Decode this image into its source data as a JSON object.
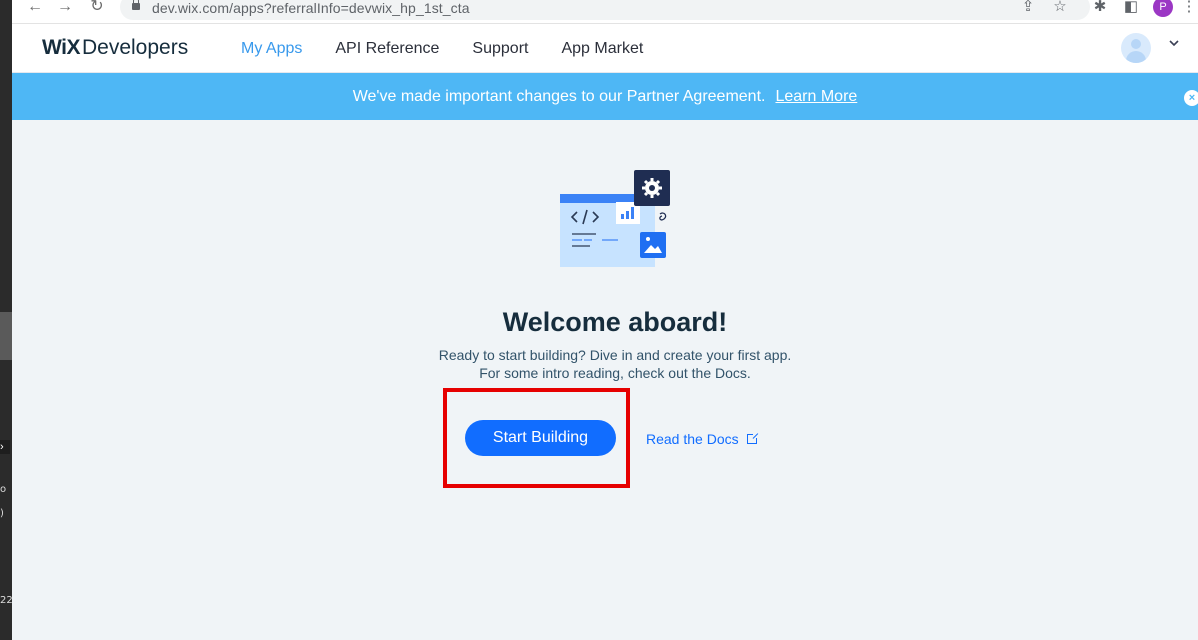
{
  "browser": {
    "url": "dev.wix.com/apps?referralInfo=devwix_hp_1st_cta",
    "profile_initial": "P"
  },
  "header": {
    "logo_wix": "WiX",
    "logo_developers": "Developers",
    "nav": [
      {
        "label": "My Apps",
        "active": true
      },
      {
        "label": "API Reference",
        "active": false
      },
      {
        "label": "Support",
        "active": false
      },
      {
        "label": "App Market",
        "active": false
      }
    ]
  },
  "banner": {
    "message": "We've made important changes to our Partner Agreement.",
    "link": "Learn More"
  },
  "welcome": {
    "title": "Welcome aboard!",
    "line1": "Ready to start building? Dive in and create your first app.",
    "line2": "For some intro reading, check out the Docs.",
    "primary_button": "Start Building",
    "docs_link": "Read the Docs"
  },
  "left_edge": {
    "num": "22"
  },
  "colors": {
    "accent": "#116dff",
    "nav_active": "#3899ec",
    "banner": "#4eb7f5",
    "highlight": "#e60000",
    "background": "#f0f4f7"
  },
  "icons": [
    "back-icon",
    "forward-icon",
    "reload-icon",
    "lock-icon",
    "share-icon",
    "star-icon",
    "extensions-icon",
    "sidepanel-icon",
    "menu-icon",
    "chevron-down-icon",
    "close-icon",
    "external-link-icon",
    "gear-icon",
    "chart-icon",
    "image-icon",
    "code-icon"
  ]
}
